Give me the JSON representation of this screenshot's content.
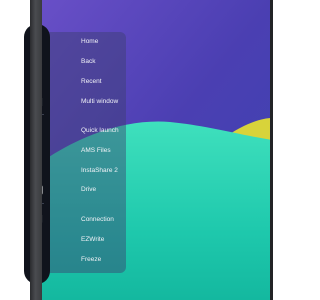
{
  "menu": {
    "items": [
      {
        "label": "Home",
        "icon": "home-icon"
      },
      {
        "label": "Back",
        "icon": "back-icon"
      },
      {
        "label": "Recent",
        "icon": "recent-icon"
      },
      {
        "label": "Multi window",
        "icon": "multi-window-icon"
      },
      {
        "label": "Quick launch",
        "icon": "quick-launch-icon"
      },
      {
        "label": "AMS Files",
        "icon": "ams-files-icon"
      },
      {
        "label": "InstaShare 2",
        "icon": "instashare-icon"
      },
      {
        "label": "Drive",
        "icon": "drive-icon"
      },
      {
        "label": "Connection",
        "icon": "connection-icon"
      },
      {
        "label": "EZWrite",
        "icon": "ezwrite-icon"
      },
      {
        "label": "Freeze",
        "icon": "freeze-icon"
      }
    ]
  },
  "colors": {
    "wallpaper_purple": "#4c3fb0",
    "wallpaper_teal": "#23d6b4",
    "wallpaper_yellow": "#d8d33a",
    "dock": "#10131c",
    "text": "#f2f3f8"
  }
}
